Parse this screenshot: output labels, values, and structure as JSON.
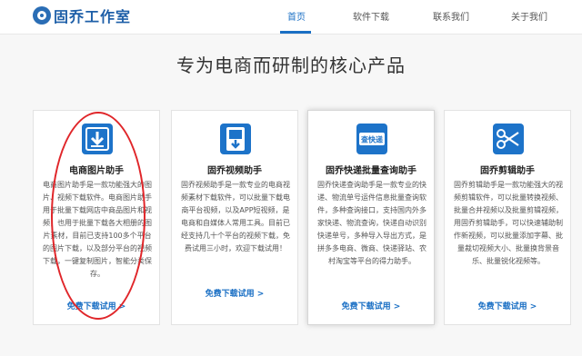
{
  "header": {
    "logo_text": "固乔工作室",
    "nav": [
      {
        "label": "首页",
        "active": true
      },
      {
        "label": "软件下载",
        "active": false
      },
      {
        "label": "联系我们",
        "active": false
      },
      {
        "label": "关于我们",
        "active": false
      }
    ]
  },
  "main": {
    "heading": "专为电商而研制的核心产品"
  },
  "cards": [
    {
      "title": "电商图片助手",
      "icon": "download-icon",
      "desc": "电商图片助手是一款功能强大的图片、视频下载软件。电商图片助手用于批量下载网店中商品图片和视频，也用于批量下载各大相册的图片素材，目前已支持100多个平台的图片下载，以及部分平台的视频下载，一键复制图片，智能分类保存。",
      "link": "免费下载试用 >"
    },
    {
      "title": "固乔视频助手",
      "icon": "video-download-icon",
      "desc": "固乔视频助手是一款专业的电商视频素材下载软件，可以批量下载电商平台视频，以及APP短视频，是电商和自媒体人常用工具。目前已经支持几十个平台的视频下载，免费试用三小时，欢迎下载试用！",
      "link": "免费下载试用 >"
    },
    {
      "title": "固乔快递批量查询助手",
      "icon": "express-query-icon",
      "icon_text": "查快递",
      "desc": "固乔快递查询助手是一款专业的快递、物流单号运件信息批量查询软件，多种查询接口，支持国内外多家快递、物流查询，快递自动识别快递单号，多种导入导出方式，是拼多多电商、微商、快递驿站、农村淘宝等平台的得力助手。",
      "link": "免费下载试用 >"
    },
    {
      "title": "固乔剪辑助手",
      "icon": "scissors-icon",
      "desc": "固乔剪辑助手是一款功能强大的视频剪辑软件，可以批量转换视频、批量合并视频以及批量剪辑视频，用固乔剪辑助手，可以快速辅助制作新视频，可以批量添加字幕、批量裁切视频大小、批量换背景音乐、批量锐化视频等。",
      "link": "免费下载试用 >"
    }
  ],
  "colors": {
    "accent": "#1a6fc4",
    "icon_bg": "#1d73c9",
    "annotation": "#e0262a"
  }
}
